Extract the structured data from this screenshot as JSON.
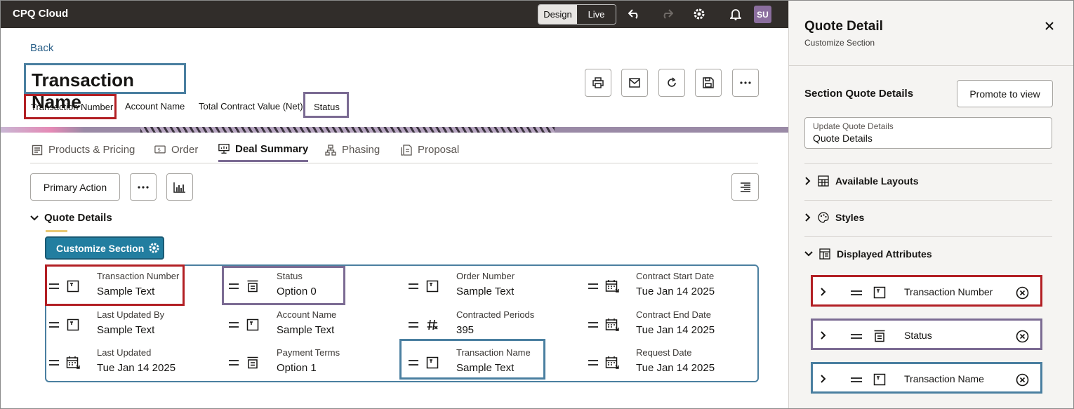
{
  "app": {
    "title": "CPQ Cloud",
    "mode_design": "Design",
    "mode_live": "Live",
    "user_initials": "SU"
  },
  "header": {
    "back": "Back",
    "title": "Transaction Name",
    "meta": [
      "Transaction Number",
      "Account Name",
      "Total Contract Value (Net)",
      "Status"
    ]
  },
  "tabs": [
    "Products & Pricing",
    "Order",
    "Deal Summary",
    "Phasing",
    "Proposal"
  ],
  "active_tab": "Deal Summary",
  "toolbar": {
    "primary_action": "Primary Action"
  },
  "section": {
    "title": "Quote Details",
    "customize": "Customize Section"
  },
  "fields": [
    {
      "label": "Transaction Number",
      "value": "Sample Text",
      "icon": "text-field-icon"
    },
    {
      "label": "Status",
      "value": "Option 0",
      "icon": "select-field-icon"
    },
    {
      "label": "Order Number",
      "value": "Sample Text",
      "icon": "text-field-icon"
    },
    {
      "label": "Contract Start Date",
      "value": "Tue Jan 14 2025",
      "icon": "calendar-icon"
    },
    {
      "label": "Last Updated By",
      "value": "Sample Text",
      "icon": "text-field-icon"
    },
    {
      "label": "Account Name",
      "value": "Sample Text",
      "icon": "text-field-icon"
    },
    {
      "label": "Contracted Periods",
      "value": "395",
      "icon": "number-field-icon"
    },
    {
      "label": "Contract End Date",
      "value": "Tue Jan 14 2025",
      "icon": "calendar-icon"
    },
    {
      "label": "Last Updated",
      "value": "Tue Jan 14 2025",
      "icon": "calendar-icon"
    },
    {
      "label": "Payment Terms",
      "value": "Option 1",
      "icon": "select-field-icon"
    },
    {
      "label": "Transaction Name",
      "value": "Sample Text",
      "icon": "text-field-icon"
    },
    {
      "label": "Request Date",
      "value": "Tue Jan 14 2025",
      "icon": "calendar-icon"
    }
  ],
  "panel": {
    "title": "Quote Detail",
    "subtitle": "Customize Section",
    "section_title": "Section Quote Details",
    "promote": "Promote to view",
    "input_label": "Update Quote Details",
    "input_value": "Quote Details",
    "available_layouts": "Available Layouts",
    "styles": "Styles",
    "displayed_attributes": "Displayed Attributes",
    "attributes": [
      "Transaction Number",
      "Status",
      "Transaction Name"
    ]
  },
  "colors": {
    "highlight_red": "#b21f24",
    "highlight_purple": "#7b6b93",
    "highlight_blue": "#4a7fa0",
    "accent_teal": "#227ea0"
  }
}
